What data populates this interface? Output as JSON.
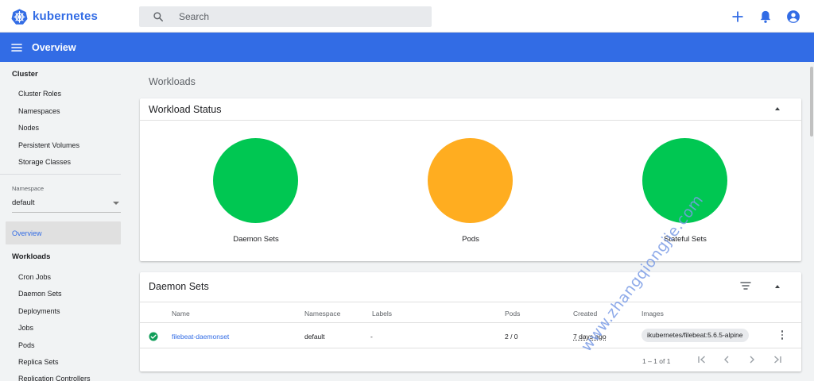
{
  "app": {
    "name": "kubernetes"
  },
  "search": {
    "placeholder": "Search"
  },
  "header": {
    "title": "Overview"
  },
  "sidebar": {
    "cluster_heading": "Cluster",
    "cluster_items": [
      "Cluster Roles",
      "Namespaces",
      "Nodes",
      "Persistent Volumes",
      "Storage Classes"
    ],
    "namespace_label": "Namespace",
    "namespace_value": "default",
    "overview_label": "Overview",
    "workloads_heading": "Workloads",
    "workload_items": [
      "Cron Jobs",
      "Daemon Sets",
      "Deployments",
      "Jobs",
      "Pods",
      "Replica Sets",
      "Replication Controllers"
    ]
  },
  "main": {
    "page_title": "Workloads",
    "workload_status": {
      "title": "Workload Status",
      "items": [
        {
          "label": "Daemon Sets",
          "color": "#00c752"
        },
        {
          "label": "Pods",
          "color": "#ffad20"
        },
        {
          "label": "Stateful Sets",
          "color": "#00c752"
        }
      ]
    },
    "daemon_sets": {
      "title": "Daemon Sets",
      "columns": [
        "Name",
        "Namespace",
        "Labels",
        "Pods",
        "Created",
        "Images"
      ],
      "rows": [
        {
          "name": "filebeat-daemonset",
          "namespace": "default",
          "labels": "-",
          "pods": "2 / 0",
          "created": "7 days ago",
          "image": "ikubernetes/filebeat:5.6.5-alpine"
        }
      ],
      "pagination": "1 – 1 of 1"
    }
  },
  "watermark": "www.zhangqiongjie.com",
  "colors": {
    "brand": "#326ce5",
    "success": "#00c752",
    "warning": "#ffad20"
  }
}
